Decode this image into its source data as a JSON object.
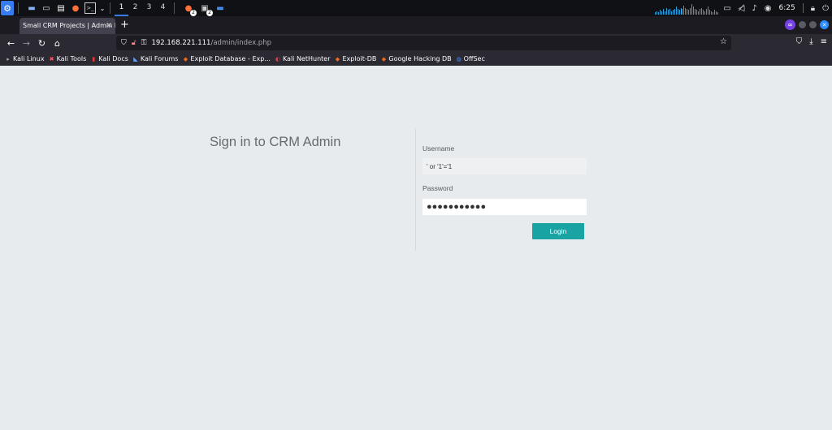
{
  "panel": {
    "workspaces": [
      "1",
      "2",
      "3",
      "4"
    ],
    "active_workspace": "1",
    "badge_1": "2",
    "badge_2": "2",
    "clock": "6:25",
    "activity_graph_levels": [
      2,
      3,
      2,
      4,
      3,
      5,
      3,
      6,
      4,
      5,
      3,
      4,
      5,
      7,
      5,
      4,
      6,
      5,
      8,
      6,
      5,
      4,
      6,
      9,
      7,
      5,
      4,
      3,
      5,
      6,
      4,
      3,
      5,
      7,
      4,
      3,
      2,
      4,
      3,
      2
    ],
    "accent_color": "#367bf0"
  },
  "browser": {
    "tab_title": "Small CRM Projects | Admin L",
    "url_host": "192.168.221.111",
    "url_path": "/admin/index.php",
    "bookmarks": [
      {
        "label": "Kali Linux",
        "icon": "kali-dragon-icon"
      },
      {
        "label": "Kali Tools",
        "icon": "kali-tools-icon"
      },
      {
        "label": "Kali Docs",
        "icon": "kali-docs-icon"
      },
      {
        "label": "Kali Forums",
        "icon": "kali-forums-icon"
      },
      {
        "label": "Exploit Database - Exp...",
        "icon": "exploit-db-icon"
      },
      {
        "label": "Kali NetHunter",
        "icon": "nethunter-icon"
      },
      {
        "label": "Exploit-DB",
        "icon": "exploit-db-icon"
      },
      {
        "label": "Google Hacking DB",
        "icon": "exploit-db-icon"
      },
      {
        "label": "OffSec",
        "icon": "offsec-icon"
      }
    ]
  },
  "login": {
    "heading": "Sign in to CRM Admin",
    "username_label": "Username",
    "username_value": "' or '1'='1",
    "password_label": "Password",
    "password_value": "●●●●●●●●●●●",
    "button_label": "Login",
    "button_color": "#1aa3a3"
  }
}
